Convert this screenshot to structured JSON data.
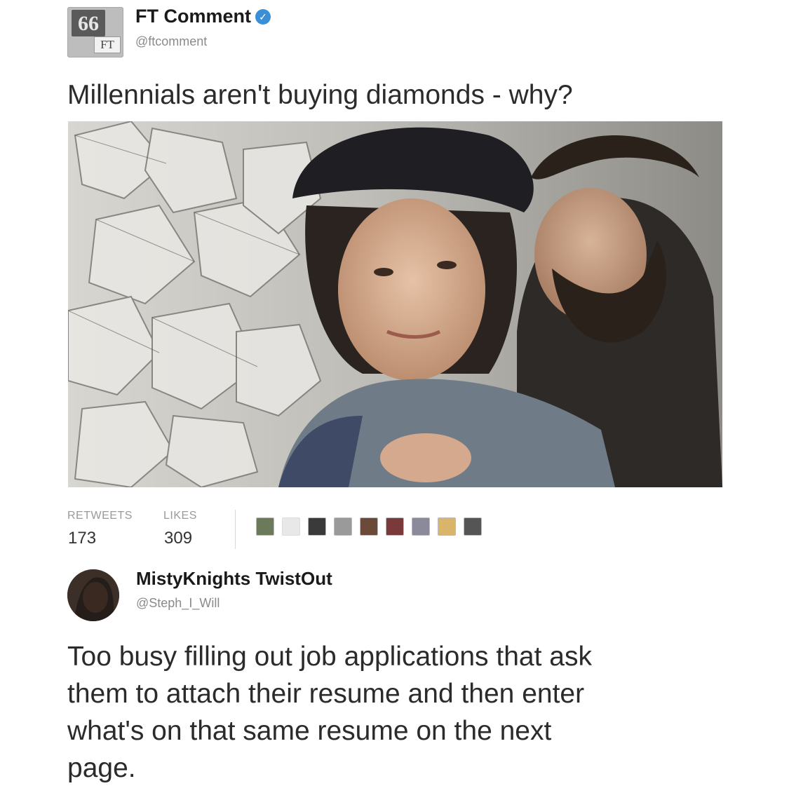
{
  "tweet": {
    "author": {
      "name": "FT Comment",
      "handle": "@ftcomment",
      "verified": true,
      "avatar_icon": "ft-quote-logo",
      "avatar_text": {
        "quote": "66",
        "brand": "FT"
      }
    },
    "text": "Millennials aren't buying diamonds - why?",
    "image_description_icon": "couple-diamonds-photo",
    "stats": {
      "retweets_label": "RETWEETS",
      "retweets": "173",
      "likes_label": "LIKES",
      "likes": "309"
    },
    "likers_count": 9
  },
  "reply": {
    "author": {
      "name": "MistyKnights TwistOut",
      "handle": "@Steph_I_Will"
    },
    "text_lines": [
      "Too busy filling out job applications that ask",
      "them to attach their resume and then enter",
      "what's on that same resume on the next",
      "page."
    ]
  },
  "colors": {
    "verified": "#3b8fd6",
    "handle": "#8a8a8a"
  }
}
